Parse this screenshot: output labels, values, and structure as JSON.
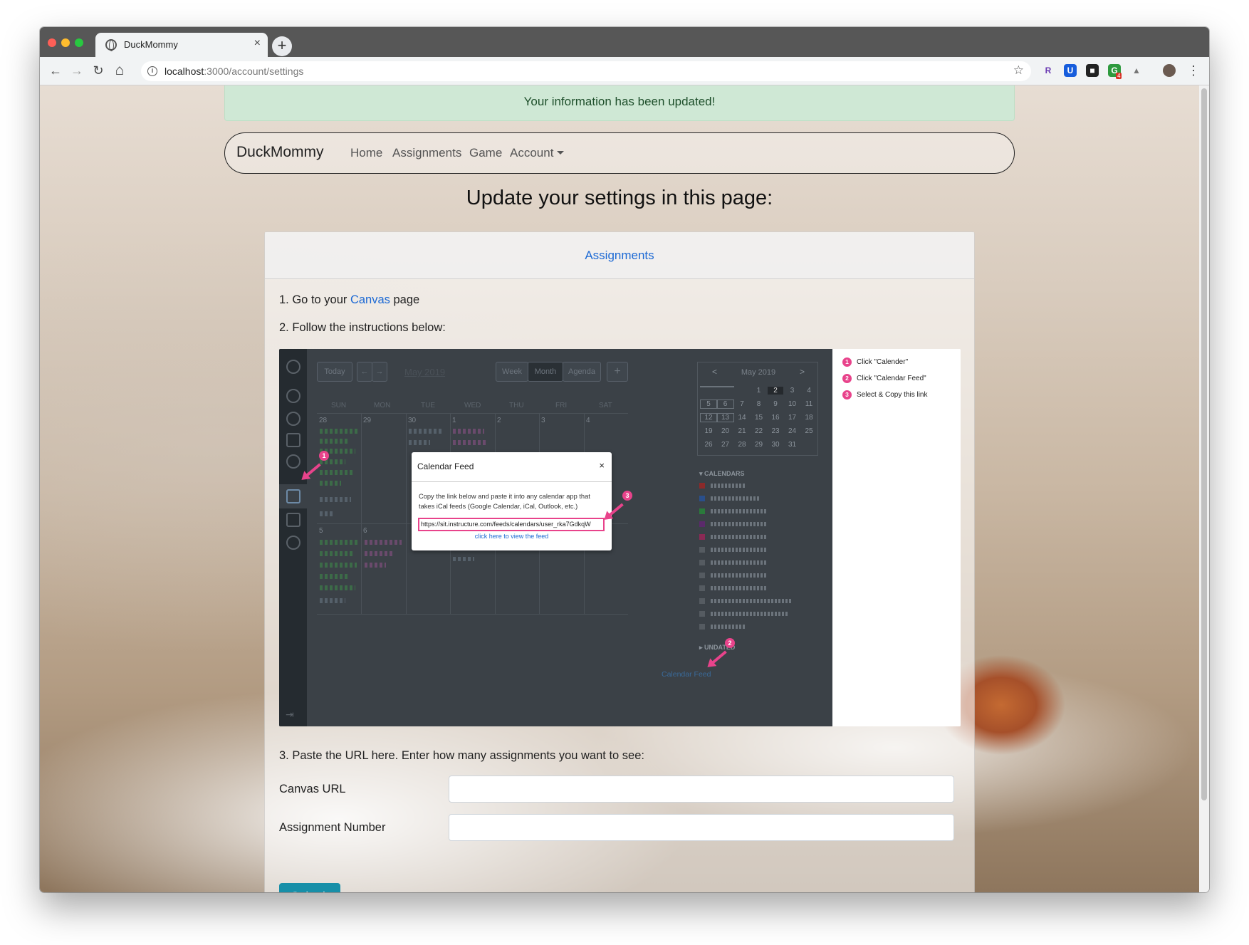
{
  "browser": {
    "tab_title": "DuckMommy",
    "tab_close": "×",
    "new_tab": "+",
    "back_icon": "←",
    "forward_icon": "→",
    "reload_icon": "↻",
    "home_icon": "⌂",
    "url_host": "localhost",
    "url_path": ":3000/account/settings",
    "star_icon": "☆",
    "menu_icon": "⋮",
    "extensions": [
      "R",
      "U",
      "■",
      "G",
      "▲"
    ],
    "extension_badge": "4"
  },
  "alert": {
    "message": "Your information has been updated!"
  },
  "navbar": {
    "brand": "DuckMommy",
    "links": [
      "Home",
      "Assignments",
      "Game"
    ],
    "account_label": "Account"
  },
  "page": {
    "heading": "Update your settings in this page:"
  },
  "card": {
    "header": "Assignments",
    "step1_prefix": "1. Go to your ",
    "step1_link": "Canvas",
    "step1_suffix": " page",
    "step2": "2. Follow the instructions below:",
    "step3": "3. Paste the URL here. Enter how many assignments you want to see:"
  },
  "instructions_image": {
    "toolbar": {
      "today": "Today",
      "prev": "←",
      "next": "→",
      "month_label": "May 2019",
      "week": "Week",
      "month": "Month",
      "agenda": "Agenda",
      "add": "+"
    },
    "days": [
      "SUN",
      "MON",
      "TUE",
      "WED",
      "THU",
      "FRI",
      "SAT"
    ],
    "week1_dates": [
      "28",
      "29",
      "30",
      "1",
      "2",
      "3",
      "4"
    ],
    "week2_dates": [
      "5",
      "6"
    ],
    "mini_calendar": {
      "title": "May 2019",
      "prev": "<",
      "next": ">",
      "rows": [
        [
          "",
          "",
          "",
          "1",
          "2",
          "3",
          "4"
        ],
        [
          "5",
          "6",
          "7",
          "8",
          "9",
          "10",
          "11"
        ],
        [
          "12",
          "13",
          "14",
          "15",
          "16",
          "17",
          "18"
        ],
        [
          "19",
          "20",
          "21",
          "22",
          "23",
          "24",
          "25"
        ],
        [
          "26",
          "27",
          "28",
          "29",
          "30",
          "31",
          ""
        ]
      ]
    },
    "calendars_header": "▾ CALENDARS",
    "undated_header": "▸ UNDATED",
    "calendar_feed_link": "Calendar Feed",
    "modal": {
      "title": "Calendar Feed",
      "close": "×",
      "body": "Copy the link below and paste it into any calendar app that takes iCal feeds (Google Calendar, iCal, Outlook, etc.)",
      "url": "https://sit.instructure.com/feeds/calendars/user_rka7GdkqW",
      "view_link": "click here to view the feed"
    },
    "markers": [
      "1",
      "2",
      "3"
    ],
    "legend": [
      {
        "num": "1",
        "text": "Click \"Calender\""
      },
      {
        "num": "2",
        "text": "Click \"Calendar Feed\""
      },
      {
        "num": "3",
        "text": "Select & Copy this link"
      }
    ],
    "colors": {
      "marker": "#e8438b",
      "canvas_bg": "#3b4147"
    }
  },
  "form": {
    "canvas_url_label": "Canvas URL",
    "canvas_url_value": "",
    "assignment_number_label": "Assignment Number",
    "assignment_number_value": "",
    "submit_label": "Submit"
  },
  "colors": {
    "primary_link": "#1c69d4",
    "submit": "#178fa8",
    "alert_bg": "#cfe8d5"
  }
}
